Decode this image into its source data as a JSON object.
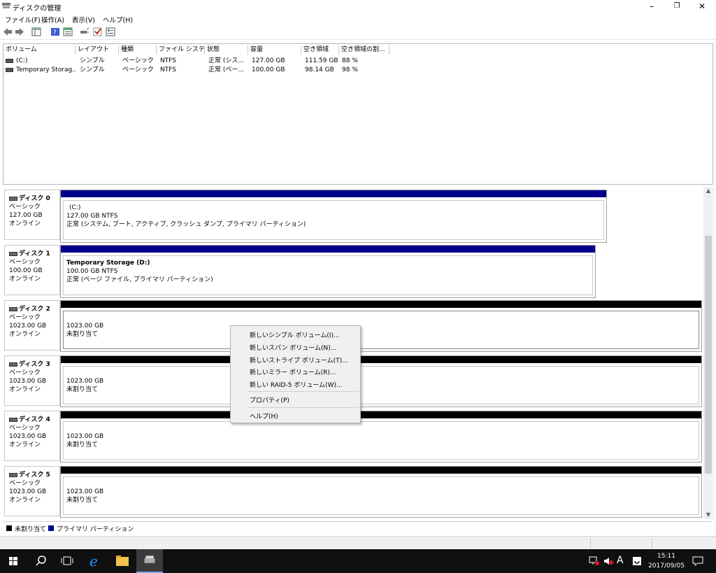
{
  "window": {
    "title": "ディスクの管理",
    "min": "–",
    "restore": "❐",
    "close": "✕"
  },
  "menu": [
    "ファイル(F)",
    "操作(A)",
    "表示(V)",
    "ヘルプ(H)"
  ],
  "columns": [
    "ボリューム",
    "レイアウト",
    "種類",
    "ファイル システム",
    "状態",
    "容量",
    "空き領域",
    "空き領域の割..."
  ],
  "volumes": [
    {
      "name": "(C:)",
      "layout": "シンプル",
      "type": "ベーシック",
      "fs": "NTFS",
      "status": "正常 (シス...",
      "capacity": "127.00 GB",
      "free": "111.59 GB",
      "percent": "88 %"
    },
    {
      "name": "Temporary Storag...",
      "layout": "シンプル",
      "type": "ベーシック",
      "fs": "NTFS",
      "status": "正常 (ペー...",
      "capacity": "100.00 GB",
      "free": "98.14 GB",
      "percent": "98 %"
    }
  ],
  "disks": [
    {
      "name": "ディスク 0",
      "type": "ベーシック",
      "size": "127.00 GB",
      "state": "オンライン",
      "part": {
        "title": "(C:)",
        "line1": "127.00 GB NTFS",
        "line2": "正常 (システム, ブート, アクティブ, クラッシュ ダンプ, プライマリ パーティション)"
      }
    },
    {
      "name": "ディスク 1",
      "type": "ベーシック",
      "size": "100.00 GB",
      "state": "オンライン",
      "part": {
        "title": "Temporary Storage  (D:)",
        "line1": "100.00 GB NTFS",
        "line2": "正常 (ページ ファイル, プライマリ パーティション)"
      }
    },
    {
      "name": "ディスク 2",
      "type": "ベーシック",
      "size": "1023.00 GB",
      "state": "オンライン",
      "part": {
        "line1": "1023.00 GB",
        "line2": "未割り当て"
      }
    },
    {
      "name": "ディスク 3",
      "type": "ベーシック",
      "size": "1023.00 GB",
      "state": "オンライン",
      "part": {
        "line1": "1023.00 GB",
        "line2": "未割り当て"
      }
    },
    {
      "name": "ディスク 4",
      "type": "ベーシック",
      "size": "1023.00 GB",
      "state": "オンライン",
      "part": {
        "line1": "1023.00 GB",
        "line2": "未割り当て"
      }
    },
    {
      "name": "ディスク 5",
      "type": "ベーシック",
      "size": "1023.00 GB",
      "state": "オンライン",
      "part": {
        "line1": "1023.00 GB",
        "line2": "未割り当て"
      }
    }
  ],
  "legend": {
    "unallocated": "未割り当て",
    "primary": "プライマリ パーティション"
  },
  "colors": {
    "primary": "#00008b",
    "unallocated": "#000000"
  },
  "context_menu": {
    "items": [
      "新しいシンプル ボリューム(I)...",
      "新しいスパン ボリューム(N)...",
      "新しいストライプ ボリューム(T)...",
      "新しいミラー ボリューム(R)...",
      "新しい RAID-5 ボリューム(W)..."
    ],
    "properties": "プロパティ(P)",
    "help": "ヘルプ(H)"
  },
  "taskbar": {
    "time": "15:11",
    "date": "2017/09/05",
    "ime": "A"
  }
}
